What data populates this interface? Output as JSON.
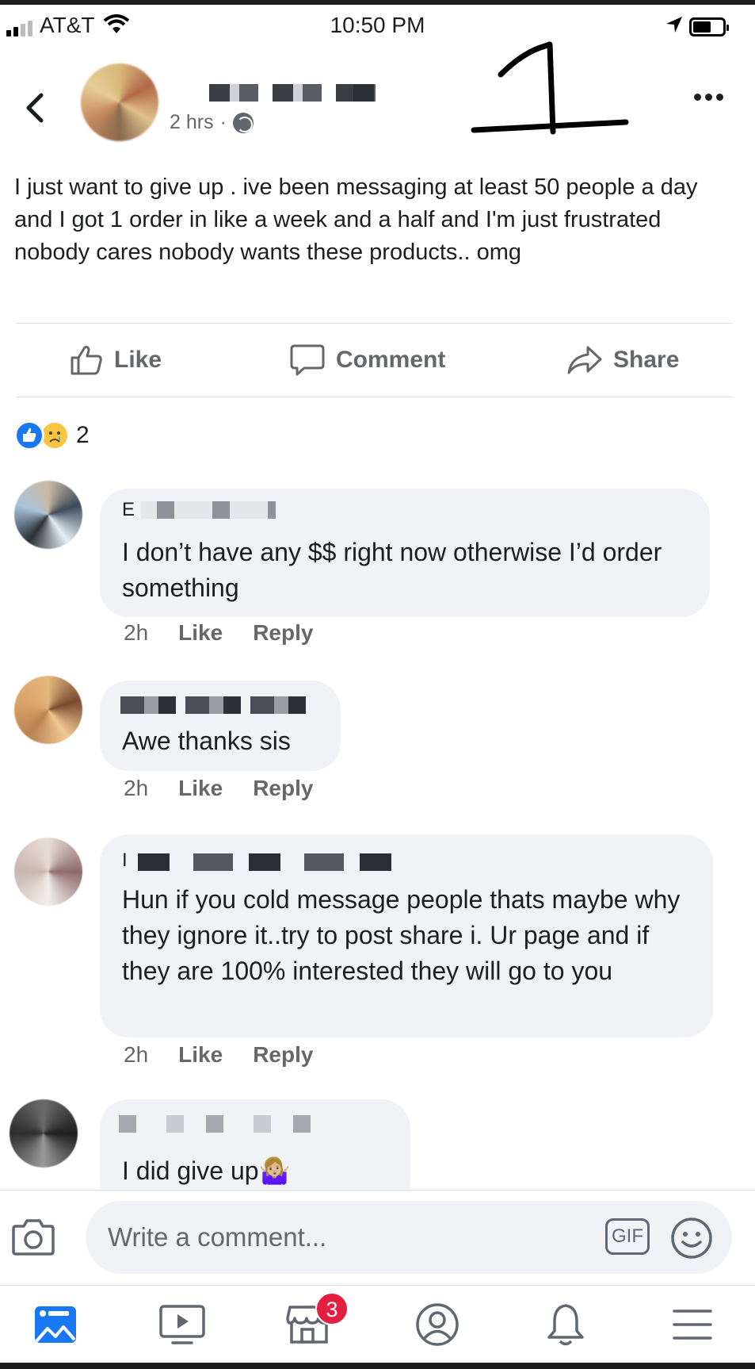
{
  "status_bar": {
    "carrier": "AT&T",
    "time": "10:50 PM"
  },
  "post": {
    "time": "2 hrs",
    "separator": "·",
    "text": "I just want to give up . ive been messaging at least 50 people a day and I got 1 order in like a week and a half and I'm just frustrated nobody cares nobody wants these products.. omg",
    "actions": {
      "like": "Like",
      "comment": "Comment",
      "share": "Share"
    },
    "reaction_count": "2",
    "reactions": [
      "like-icon",
      "sad-icon"
    ]
  },
  "comments": [
    {
      "initial": "E",
      "text": "I don’t have any $$ right now otherwise I’d order something",
      "time": "2h",
      "like": "Like",
      "reply": "Reply"
    },
    {
      "text": "Awe thanks sis",
      "time": "2h",
      "like": "Like",
      "reply": "Reply"
    },
    {
      "initial": "I",
      "text": "Hun if you cold message people thats maybe why they ignore it..try to post share i. Ur page and if they are 100% interested they will go to you",
      "time": "2h",
      "like": "Like",
      "reply": "Reply"
    },
    {
      "text": "I did give up🤷🏼‍♀️"
    }
  ],
  "composer": {
    "placeholder": "Write a comment...",
    "gif_label": "GIF"
  },
  "tab_bar": {
    "items": [
      "news-feed-icon",
      "watch-icon",
      "marketplace-icon",
      "profile-icon",
      "notifications-icon",
      "menu-icon"
    ],
    "marketplace_badge": "3"
  },
  "colors": {
    "accent": "#1877f2",
    "badge": "#e41e3f",
    "bubble": "#f0f2f5",
    "meta_text": "#65676b"
  }
}
